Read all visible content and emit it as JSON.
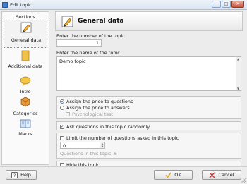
{
  "window": {
    "title": "Edit topic",
    "buttons": {
      "minimize": "–",
      "maximize": "□",
      "close": "✕"
    }
  },
  "sidebar": {
    "header": "Sections",
    "items": [
      {
        "label": "General data",
        "icon": "pencil-icon",
        "selected": true
      },
      {
        "label": "Additional data",
        "icon": "note-icon",
        "selected": false
      },
      {
        "label": "Intro",
        "icon": "speech-bubble-icon",
        "selected": false
      },
      {
        "label": "Categories",
        "icon": "box-icon",
        "selected": false
      },
      {
        "label": "Marks",
        "icon": "book-icon",
        "selected": false
      }
    ]
  },
  "header": {
    "title": "General data",
    "icon": "pencil-icon"
  },
  "form": {
    "number_label": "Enter the number of the topic",
    "number_value": "1",
    "name_label": "Enter the name of the topic",
    "name_value": "Demo topic",
    "price_options": [
      {
        "label": "Assign the price to questions",
        "selected": true
      },
      {
        "label": "Assign the price to answers",
        "selected": false
      }
    ],
    "psychological_label": "Psychological test",
    "psychological_checked": false,
    "random_label": "Ask questions in this topic randomly",
    "random_checked": true,
    "limit_label": "Limit the number of questions asked in this topic",
    "limit_checked": false,
    "limit_value": "0",
    "questions_in_topic": "Questions in this topic: 6",
    "hide_label": "Hide this topic",
    "hide_checked": false
  },
  "footer": {
    "help_label": "Help",
    "ok_label": "OK",
    "cancel_label": "Cancel"
  },
  "colors": {
    "accent": "#2a6bd0",
    "titlebar": "#dbe6f3",
    "close": "#c9533d"
  }
}
